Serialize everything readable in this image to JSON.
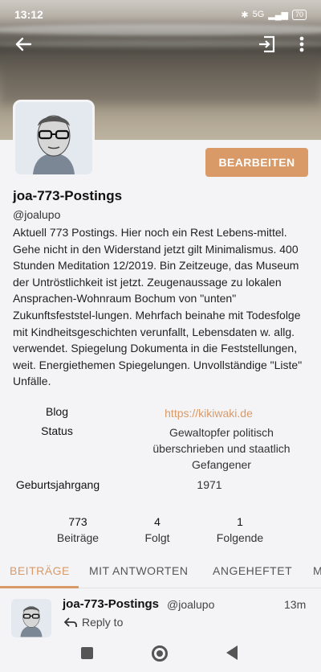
{
  "status_bar": {
    "time": "13:12",
    "network": "5G",
    "battery": "70"
  },
  "profile": {
    "display_name": "joa-773-Postings",
    "handle": "@joalupo",
    "edit_button": "BEARBEITEN",
    "bio": "Aktuell 773 Postings. Hier noch ein Rest Lebens-mittel. Gehe nicht in den Widerstand jetzt gilt Minimalismus. 400 Stunden Meditation 12/2019. Bin Zeitzeuge, das Museum der Untröstlichkeit ist jetzt. Zeugenaussage zu lokalen Ansprachen-Wohnraum Bochum von \"unten\" Zukunftsfeststel-lungen. Mehrfach beinahe mit Todesfolge mit Kindheitsgeschichten verunfallt, Lebensdaten w. allg. verwendet. Spiegelung Dokumenta in die Feststellungen, weit. Energiethemen Spiegelungen. Unvollständige \"Liste\" Unfälle.",
    "fields": [
      {
        "label": "Blog",
        "value": "https://kikiwaki.de"
      },
      {
        "label": "Status",
        "value": "Gewaltopfer politisch überschrieben und staatlich Gefangener"
      },
      {
        "label": "Geburtsjahrgang",
        "value": "1971"
      }
    ],
    "stats": [
      {
        "count": "773",
        "label": "Beiträge"
      },
      {
        "count": "4",
        "label": "Folgt"
      },
      {
        "count": "1",
        "label": "Folgende"
      }
    ]
  },
  "tabs": [
    "BEITRÄGE",
    "MIT ANTWORTEN",
    "ANGEHEFTET",
    "M"
  ],
  "post": {
    "author": "joa-773-Postings",
    "handle": "@joalupo",
    "time": "13m",
    "reply_label": "Reply to"
  },
  "colors": {
    "accent": "#d99a67",
    "background": "#f4f4f6"
  }
}
